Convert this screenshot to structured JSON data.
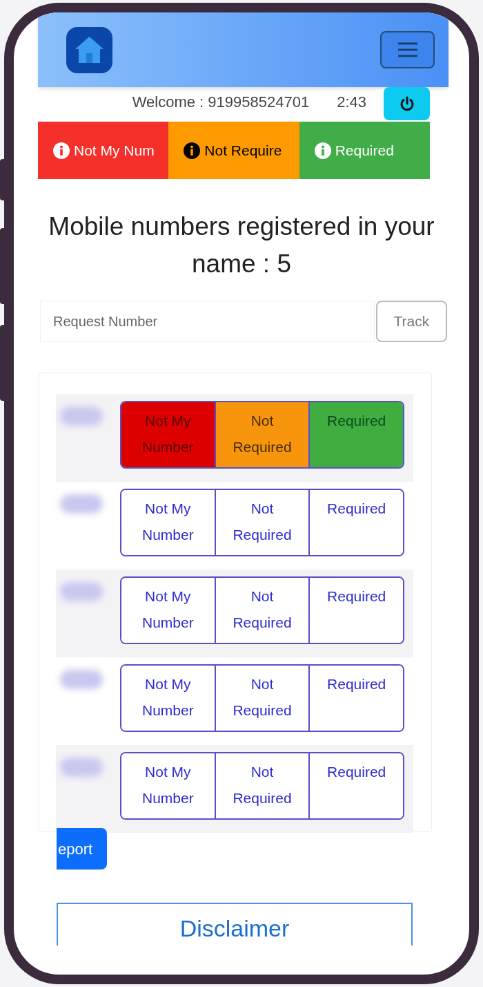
{
  "welcome": {
    "text": "Welcome : 919958524701",
    "time": "2:43"
  },
  "legend": [
    {
      "label": "Not My Num"
    },
    {
      "label": "Not Require"
    },
    {
      "label": "Required"
    }
  ],
  "heading": "Mobile numbers registered in your name : 5",
  "search": {
    "placeholder": "Request Number",
    "button": "Track"
  },
  "rows": [
    {
      "options": [
        {
          "label": "Not My Number",
          "selected": true
        },
        {
          "label": "Not Required",
          "selected": true
        },
        {
          "label": "Required",
          "selected": true
        }
      ]
    },
    {
      "options": [
        {
          "label": "Not My Number",
          "selected": false
        },
        {
          "label": "Not Required",
          "selected": false
        },
        {
          "label": "Required",
          "selected": false
        }
      ]
    },
    {
      "options": [
        {
          "label": "Not My Number",
          "selected": false
        },
        {
          "label": "Not Required",
          "selected": false
        },
        {
          "label": "Required",
          "selected": false
        }
      ]
    },
    {
      "options": [
        {
          "label": "Not My Number",
          "selected": false
        },
        {
          "label": "Not Required",
          "selected": false
        },
        {
          "label": "Required",
          "selected": false
        }
      ]
    },
    {
      "options": [
        {
          "label": "Not My Number",
          "selected": false
        },
        {
          "label": "Not Required",
          "selected": false
        },
        {
          "label": "Required",
          "selected": false
        }
      ]
    }
  ],
  "report_button": "eport",
  "disclaimer": "Disclaimer"
}
